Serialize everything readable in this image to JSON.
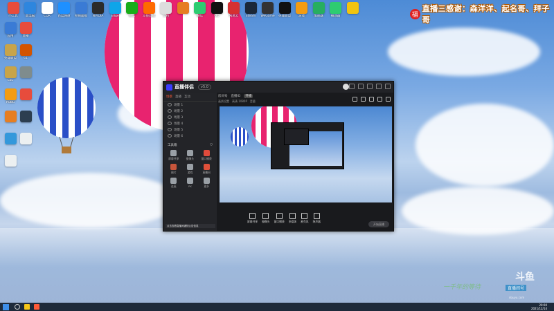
{
  "desktop": {
    "top_icons": [
      {
        "label": "小工具",
        "color": "#e74c3c"
      },
      {
        "label": "此电脑",
        "color": "#2e86de"
      },
      {
        "label": "CDR",
        "color": "#ffffff"
      },
      {
        "label": "百度网盘",
        "color": "#1e90ff"
      },
      {
        "label": "控制面板",
        "color": "#3a7bd5"
      },
      {
        "label": "NVIDIA",
        "color": "#2b2b2b"
      },
      {
        "label": "Edge",
        "color": "#0ea5e9"
      },
      {
        "label": "微信",
        "color": "#1aad19"
      },
      {
        "label": "斗鱼直播",
        "color": "#ff6a00"
      },
      {
        "label": "文档",
        "color": "#dddddd"
      },
      {
        "label": "",
        "color": "#e67e22"
      },
      {
        "label": "微信",
        "color": "#2ecc71"
      },
      {
        "label": "QQ",
        "color": "#111111"
      },
      {
        "label": "网易云",
        "color": "#d63031"
      },
      {
        "label": "Steam",
        "color": "#1b2838"
      },
      {
        "label": "WeGame",
        "color": "#333333"
      },
      {
        "label": "英雄联盟",
        "color": "#111111"
      },
      {
        "label": "游戏",
        "color": "#f39c12"
      },
      {
        "label": "加速器",
        "color": "#27ae60"
      },
      {
        "label": "播放器",
        "color": "#2ecc71"
      },
      {
        "label": "",
        "color": "#f1c40f"
      }
    ],
    "left_icons": [
      {
        "label": "应用",
        "color": "#3a7bd5"
      },
      {
        "label": "直播",
        "color": "#e74c3c"
      },
      {
        "label": "英雄联盟",
        "color": "#c8a44a"
      },
      {
        "label": "61",
        "color": "#d35400"
      },
      {
        "label": "LoL",
        "color": "#c8a44a"
      },
      {
        "label": "",
        "color": "#7f8c8d"
      },
      {
        "label": "PUBG",
        "color": "#f39c12"
      },
      {
        "label": "",
        "color": "#e74c3c"
      },
      {
        "label": "",
        "color": "#e67e22"
      },
      {
        "label": "",
        "color": "#2c3e50"
      },
      {
        "label": "",
        "color": "#3498db"
      },
      {
        "label": "",
        "color": "#ecf0f1"
      },
      {
        "label": "",
        "color": "#ecf0f1"
      }
    ],
    "banner_text": "直播三感谢：森洋洋、起名哥、拜子哥",
    "banner_logo": "福"
  },
  "app": {
    "title": "直播伴侣",
    "version": "v5.0",
    "left_tabs": [
      "场景",
      "直播",
      "互动"
    ],
    "scenes": [
      "场景 1",
      "场景 2",
      "场景 3",
      "场景 4",
      "场景 5",
      "场景 6"
    ],
    "toolbox_title": "工具箱",
    "tools": [
      "屏幕共享",
      "摄像头",
      "窗口捕获",
      "图片",
      "游戏",
      "直播间",
      "连麦",
      "PK",
      "更多"
    ],
    "notice": "点击查看直播间通知公告信息",
    "info": {
      "room": "房间号",
      "id": "直播ID",
      "badge": "开播"
    },
    "sub": [
      "画质设置",
      "高清 1080P",
      "音量"
    ],
    "controls": [
      "屏幕共享",
      "摄像头",
      "窗口捕获",
      "多媒体",
      "麦克风",
      "扬声器"
    ],
    "start_label": "开始直播"
  },
  "taskbar": {
    "time": "20:00",
    "date": "2021/12/14"
  },
  "watermark": {
    "logo": "斗鱼",
    "room": "直播间号",
    "url": "douyu.com",
    "signature": "一千年的等待"
  }
}
